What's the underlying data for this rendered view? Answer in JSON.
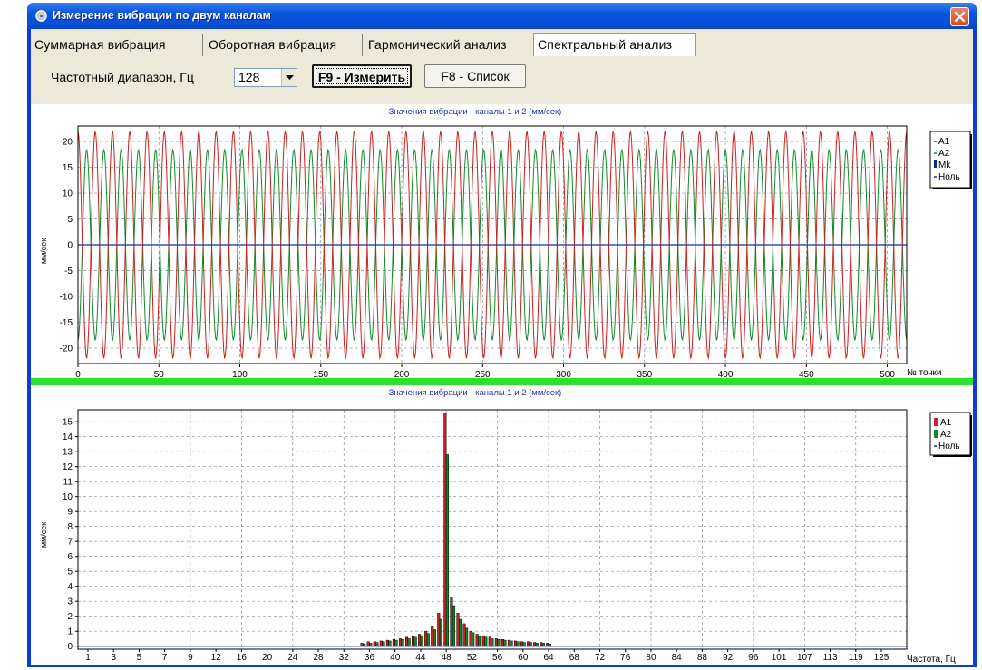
{
  "window": {
    "title": "Измерение вибрации по двум каналам"
  },
  "tabs": [
    {
      "label": "Суммарная вибрация",
      "active": false
    },
    {
      "label": "Оборотная вибрация",
      "active": false
    },
    {
      "label": "Гармонический анализ",
      "active": false
    },
    {
      "label": "Спектральный анализ",
      "active": true
    }
  ],
  "toolbar": {
    "freq_label": "Частотный  диапазон, Гц",
    "freq_value": "128",
    "measure_label": "F9 - Измерить",
    "list_label": "F8 - Список"
  },
  "colors": {
    "a1": "#cc1f1f",
    "a2": "#0f8a2a",
    "mk": "#0b2a8c",
    "zero": "#1030a0",
    "title_blue": "#1c2fb8",
    "divider": "#2ee02e"
  },
  "chart_data": [
    {
      "type": "line",
      "title": "Значения вибрации  - каналы 1 и 2 (мм/сек)",
      "xlabel": "№ точки",
      "ylabel": "мм/сек",
      "xlim": [
        0,
        512
      ],
      "ylim": [
        -23,
        23
      ],
      "x_ticks": [
        "0",
        "50",
        "100",
        "150",
        "200",
        "250",
        "300",
        "350",
        "400",
        "450",
        "500"
      ],
      "y_ticks": [
        "20",
        "15",
        "10",
        "5",
        "0",
        "-5",
        "-10",
        "-15",
        "-20"
      ],
      "grid": true,
      "legend": [
        "A1",
        "A2",
        "Mk",
        "Ноль"
      ],
      "legend_position": "right",
      "series": [
        {
          "name": "A1",
          "amplitude": 22,
          "cycles_per_512_points": 48,
          "phase_deg": 0
        },
        {
          "name": "A2",
          "amplitude": 18.5,
          "cycles_per_512_points": 48,
          "phase_deg": 180
        },
        {
          "name": "Ноль",
          "values": [
            0
          ]
        }
      ]
    },
    {
      "type": "bar",
      "title": "Значения вибрации  - каналы 1 и 2 (мм/сек)",
      "xlabel": "Частота, Гц",
      "ylabel": "мм/сек",
      "ylim": [
        -0.2,
        15.8
      ],
      "x_ticks": [
        "1",
        "3",
        "5",
        "7",
        "9",
        "12",
        "16",
        "20",
        "24",
        "28",
        "32",
        "36",
        "40",
        "44",
        "48",
        "52",
        "56",
        "60",
        "64",
        "68",
        "72",
        "76",
        "80",
        "84",
        "88",
        "92",
        "96",
        "101",
        "107",
        "113",
        "119",
        "125"
      ],
      "y_ticks": [
        "15",
        "14",
        "13",
        "12",
        "11",
        "10",
        "9",
        "8",
        "7",
        "6",
        "5",
        "4",
        "3",
        "2",
        "1",
        "0"
      ],
      "grid": true,
      "legend": [
        "A1",
        "A2",
        "Ноль"
      ],
      "legend_position": "right",
      "series": [
        {
          "name": "A1",
          "peaks": [
            {
              "x": 35,
              "value": 0.2
            },
            {
              "x": 36,
              "value": 0.3
            },
            {
              "x": 37,
              "value": 0.3
            },
            {
              "x": 38,
              "value": 0.35
            },
            {
              "x": 39,
              "value": 0.4
            },
            {
              "x": 40,
              "value": 0.45
            },
            {
              "x": 41,
              "value": 0.5
            },
            {
              "x": 42,
              "value": 0.6
            },
            {
              "x": 43,
              "value": 0.7
            },
            {
              "x": 44,
              "value": 0.8
            },
            {
              "x": 45,
              "value": 1.0
            },
            {
              "x": 46,
              "value": 1.3
            },
            {
              "x": 47,
              "value": 2.2
            },
            {
              "x": 48,
              "value": 15.6
            },
            {
              "x": 49,
              "value": 3.3
            },
            {
              "x": 50,
              "value": 2.2
            },
            {
              "x": 51,
              "value": 1.5
            },
            {
              "x": 52,
              "value": 1.0
            },
            {
              "x": 53,
              "value": 0.8
            },
            {
              "x": 54,
              "value": 0.7
            },
            {
              "x": 55,
              "value": 0.6
            },
            {
              "x": 56,
              "value": 0.5
            },
            {
              "x": 57,
              "value": 0.45
            },
            {
              "x": 58,
              "value": 0.4
            },
            {
              "x": 59,
              "value": 0.35
            },
            {
              "x": 60,
              "value": 0.3
            },
            {
              "x": 61,
              "value": 0.3
            },
            {
              "x": 62,
              "value": 0.25
            },
            {
              "x": 63,
              "value": 0.25
            },
            {
              "x": 64,
              "value": 0.2
            }
          ]
        },
        {
          "name": "A2",
          "peaks": [
            {
              "x": 35,
              "value": 0.15
            },
            {
              "x": 36,
              "value": 0.2
            },
            {
              "x": 37,
              "value": 0.25
            },
            {
              "x": 38,
              "value": 0.3
            },
            {
              "x": 39,
              "value": 0.35
            },
            {
              "x": 40,
              "value": 0.4
            },
            {
              "x": 41,
              "value": 0.45
            },
            {
              "x": 42,
              "value": 0.5
            },
            {
              "x": 43,
              "value": 0.6
            },
            {
              "x": 44,
              "value": 0.7
            },
            {
              "x": 45,
              "value": 0.85
            },
            {
              "x": 46,
              "value": 1.1
            },
            {
              "x": 47,
              "value": 1.8
            },
            {
              "x": 48,
              "value": 12.8
            },
            {
              "x": 49,
              "value": 2.7
            },
            {
              "x": 50,
              "value": 1.8
            },
            {
              "x": 51,
              "value": 1.2
            },
            {
              "x": 52,
              "value": 0.9
            },
            {
              "x": 53,
              "value": 0.7
            },
            {
              "x": 54,
              "value": 0.6
            },
            {
              "x": 55,
              "value": 0.5
            },
            {
              "x": 56,
              "value": 0.45
            },
            {
              "x": 57,
              "value": 0.4
            },
            {
              "x": 58,
              "value": 0.35
            },
            {
              "x": 59,
              "value": 0.3
            },
            {
              "x": 60,
              "value": 0.25
            },
            {
              "x": 61,
              "value": 0.25
            },
            {
              "x": 62,
              "value": 0.2
            },
            {
              "x": 63,
              "value": 0.2
            },
            {
              "x": 64,
              "value": 0.15
            }
          ]
        },
        {
          "name": "Ноль",
          "values": [
            0
          ]
        }
      ]
    }
  ]
}
